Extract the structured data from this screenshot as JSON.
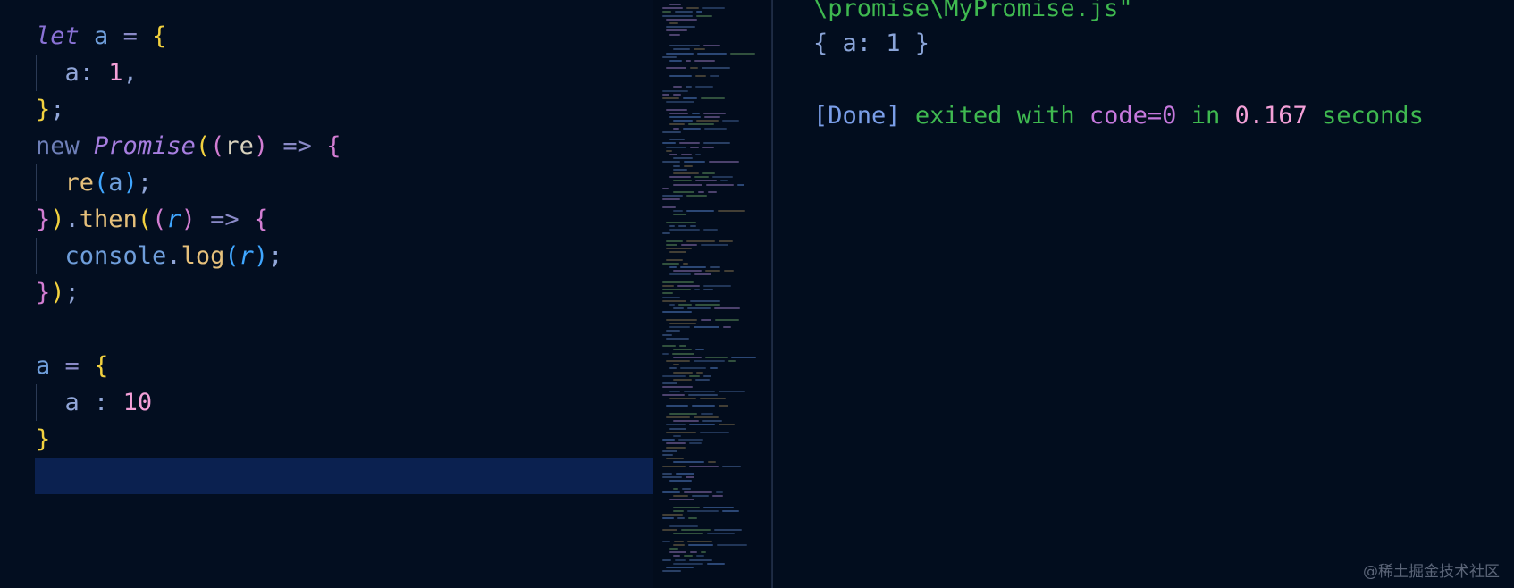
{
  "editor": {
    "lines": {
      "l1": {
        "kw": "let",
        "var": "a",
        "eq": "=",
        "open": "{"
      },
      "l2": {
        "prop": "a:",
        "num": "1",
        "comma": ","
      },
      "l3": {
        "close": "}",
        "semi": ";"
      },
      "l4": {
        "kw": "new",
        "cls": "Promise",
        "p1": "(",
        "p2": "(",
        "param": "re",
        "p3": ")",
        "arrow": "=>",
        "open": "{"
      },
      "l5": {
        "fn": "re",
        "p1": "(",
        "arg": "a",
        "p2": ")",
        "semi": ";"
      },
      "l6": {
        "close": "}",
        "p": ")",
        "dot": ".",
        "fn": "then",
        "p1": "(",
        "p2": "(",
        "param": "r",
        "p3": ")",
        "arrow": "=>",
        "open": "{"
      },
      "l7": {
        "obj": "console",
        "dot": ".",
        "fn": "log",
        "p1": "(",
        "arg": "r",
        "p2": ")",
        "semi": ";"
      },
      "l8": {
        "close": "}",
        "p": ")",
        "semi": ";"
      },
      "l10": {
        "var": "a",
        "eq": "=",
        "open": "{"
      },
      "l11": {
        "prop": "a",
        "colon": ":",
        "num": "10"
      },
      "l12": {
        "close": "}"
      }
    }
  },
  "output": {
    "path_line": "\\promise\\MyPromise.js\"",
    "result_line": "{ a: 1 }",
    "done_tag": "[Done]",
    "done_exit": "exited with",
    "done_code": "code=0",
    "done_in": "in",
    "done_time": "0.167",
    "done_unit": "seconds"
  },
  "watermark": "@稀土掘金技术社区",
  "colors": {
    "background": "#020d1e",
    "cursor_line": "#0b2150",
    "output_green": "#3fb950",
    "output_blue": "#7a9ee8",
    "output_purple": "#c678dd",
    "output_pink": "#f4a0d8"
  }
}
